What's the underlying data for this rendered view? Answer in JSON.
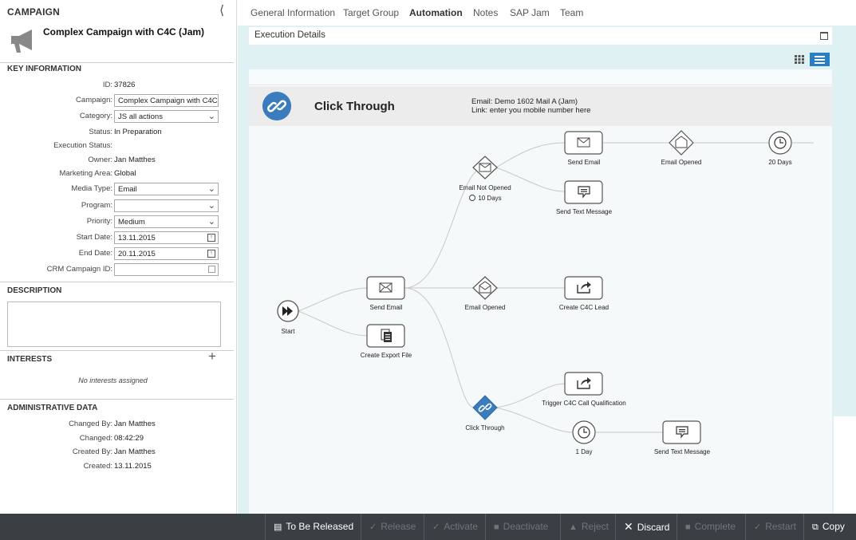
{
  "left_panel": {
    "header": "CAMPAIGN",
    "campaign_title": "Complex Campaign with C4C (Jam)",
    "key_info": {
      "heading": "KEY INFORMATION",
      "id_label": "ID:",
      "id_value": "37826",
      "campaign_label": "Campaign:",
      "campaign_value": "Complex Campaign with C4C",
      "category_label": "Category:",
      "category_value": "JS all actions",
      "status_label": "Status:",
      "status_value": "In Preparation",
      "exec_status_label": "Execution Status:",
      "owner_label": "Owner:",
      "owner_value": "Jan Matthes",
      "marketing_area_label": "Marketing Area:",
      "marketing_area_value": "Global",
      "media_type_label": "Media Type:",
      "media_type_value": "Email",
      "program_label": "Program:",
      "program_value": "",
      "priority_label": "Priority:",
      "priority_value": "Medium",
      "start_date_label": "Start Date:",
      "start_date_value": "13.11.2015",
      "end_date_label": "End Date:",
      "end_date_value": "20.11.2015",
      "crm_label": "CRM Campaign ID:",
      "crm_value": ""
    },
    "description_heading": "DESCRIPTION",
    "interests_heading": "INTERESTS",
    "interests_empty": "No interests assigned",
    "admin": {
      "heading": "ADMINISTRATIVE DATA",
      "changed_by_label": "Changed By:",
      "changed_by_value": "Jan Matthes",
      "changed_label": "Changed:",
      "changed_value": "08:42:29",
      "created_by_label": "Created By:",
      "created_by_value": "Jan Matthes",
      "created_label": "Created:",
      "created_value": "13.11.2015"
    }
  },
  "tabs": [
    {
      "label": "General Information",
      "active": false
    },
    {
      "label": "Target Group",
      "active": false
    },
    {
      "label": "Automation",
      "active": true
    },
    {
      "label": "Notes",
      "active": false
    },
    {
      "label": "SAP Jam",
      "active": false
    },
    {
      "label": "Team",
      "active": false
    }
  ],
  "execution": {
    "title": "Execution Details",
    "node_title": "Click Through",
    "node_email": "Email: Demo 1602 Mail A (Jam)",
    "node_link": "Link: enter you mobile number here"
  },
  "flow": {
    "start": "Start",
    "send_email": "Send Email",
    "create_export_file": "Create Export File",
    "email_not_opened": "Email Not Opened",
    "wait_10_days": "10 Days",
    "email_opened": "Email Opened",
    "click_through": "Click Through",
    "send_email_2": "Send Email",
    "send_text_message": "Send Text Message",
    "create_c4c_lead": "Create C4C Lead",
    "trigger_c4c_call": "Trigger C4C Call Qualification",
    "wait_1_day": "1 Day",
    "email_opened_2": "Email Opened",
    "wait_20_days": "20 Days",
    "send_text_message_2": "Send Text Message"
  },
  "footer": {
    "to_be_released": "To Be Released",
    "release": "Release",
    "activate": "Activate",
    "deactivate": "Deactivate",
    "reject": "Reject",
    "discard": "Discard",
    "complete": "Complete",
    "restart": "Restart",
    "copy": "Copy"
  },
  "colors": {
    "accent": "#2a7ec4",
    "footer_bg": "#3a3f44",
    "main_bg": "#e0f1f4"
  }
}
